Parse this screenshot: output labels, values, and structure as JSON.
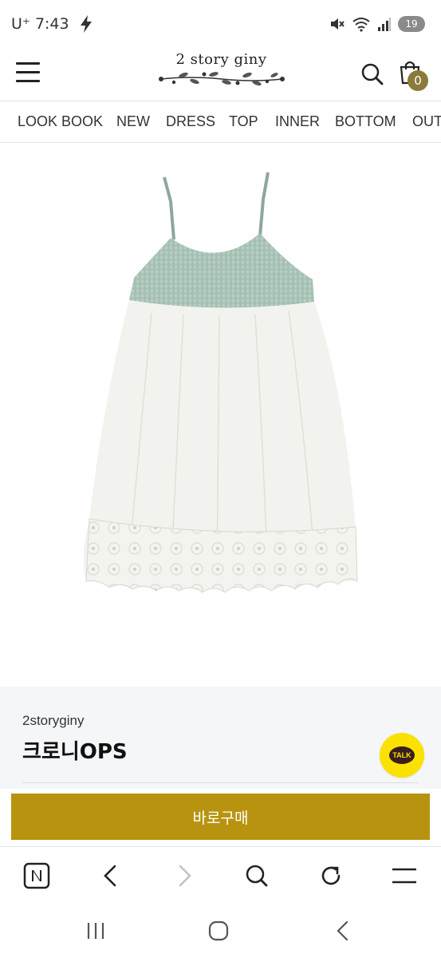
{
  "status_bar": {
    "carrier": "U⁺",
    "time": "7:43",
    "battery": "19",
    "icons": [
      "charging-bolt-icon",
      "mute-icon",
      "wifi-icon",
      "signal-icon",
      "battery-icon"
    ]
  },
  "header": {
    "logo_text": "2 story giny",
    "cart_count": "0",
    "icons": [
      "menu-icon",
      "search-icon",
      "shopping-bag-icon"
    ]
  },
  "nav": {
    "items": [
      "LOOK BOOK",
      "NEW",
      "DRESS",
      "TOP",
      "INNER",
      "BOTTOM",
      "OUTER"
    ]
  },
  "product": {
    "image_icon": "dress-product-image",
    "brand": "2storyginy",
    "name": "크로니OPS",
    "talk_label": "TALK"
  },
  "buy": {
    "label": "바로구매"
  },
  "browser_toolbar": {
    "icons": [
      "naver-n-icon",
      "back-arrow-icon",
      "forward-arrow-icon",
      "search-icon",
      "refresh-icon",
      "menu-icon"
    ]
  },
  "system_nav": {
    "icons": [
      "recent-apps-icon",
      "home-icon",
      "back-icon"
    ]
  },
  "colors": {
    "accent_gold": "#b8930f",
    "cart_badge": "#8b7a3a",
    "kakao_yellow": "#fae100",
    "info_bg": "#f5f6f8"
  }
}
